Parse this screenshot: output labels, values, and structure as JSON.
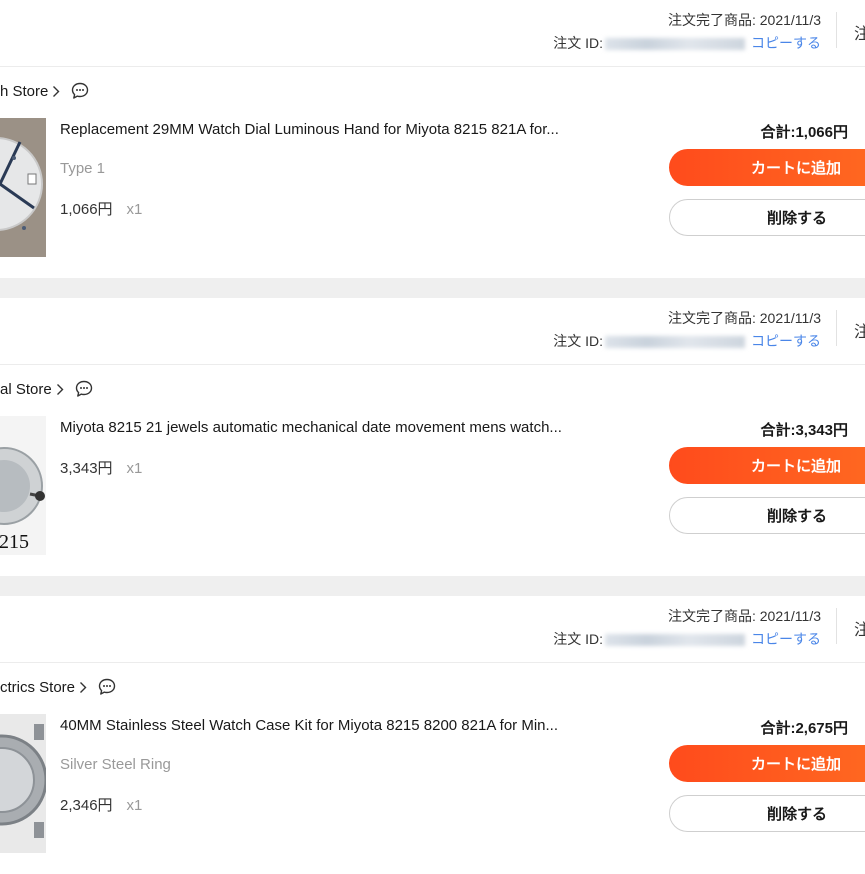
{
  "orders": [
    {
      "completed_label": "注文完了商品: 2021/11/3",
      "order_id_label": "注文 ID:",
      "copy_label": "コピーする",
      "edge_text": "注",
      "store_name": "h Store",
      "item": {
        "title": "Replacement 29MM Watch Dial Luminous Hand for Miyota 8215 821A for...",
        "variant": "Type 1",
        "price": "1,066円",
        "qty": "x1"
      },
      "total": "合計:1,066円",
      "cart_button": "カートに追加",
      "delete_button": "削除する"
    },
    {
      "completed_label": "注文完了商品: 2021/11/3",
      "order_id_label": "注文 ID:",
      "copy_label": "コピーする",
      "edge_text": "注",
      "store_name": "al Store",
      "item": {
        "title": "Miyota 8215 21 jewels automatic mechanical date movement mens watch...",
        "variant": "",
        "price": "3,343円",
        "qty": "x1",
        "thumb_text": "215"
      },
      "total": "合計:3,343円",
      "cart_button": "カートに追加",
      "delete_button": "削除する"
    },
    {
      "completed_label": "注文完了商品: 2021/11/3",
      "order_id_label": "注文 ID:",
      "copy_label": "コピーする",
      "edge_text": "注",
      "store_name": "ctrics Store",
      "item": {
        "title": "40MM Stainless Steel Watch Case Kit for Miyota 8215 8200 821A for Min...",
        "variant": "Silver Steel Ring",
        "price": "2,346円",
        "qty": "x1"
      },
      "total": "合計:2,675円",
      "cart_button": "カートに追加",
      "delete_button": "削除する"
    }
  ],
  "icons": {
    "chevron": "chevron-right-icon",
    "chat": "chat-bubble-icon"
  },
  "colors": {
    "accent": "#ff4b1c",
    "link": "#4a86e8",
    "muted": "#999999"
  }
}
